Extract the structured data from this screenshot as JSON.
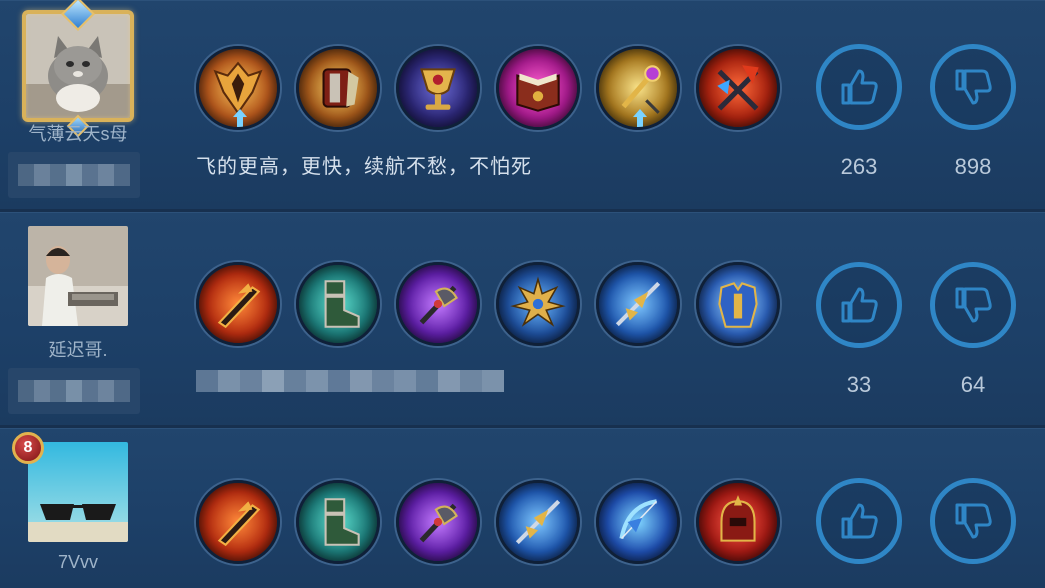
{
  "comments": [
    {
      "username": "气薄云天s母",
      "avatar": "cat-photo",
      "frame": "gold-gem-frame",
      "level_badge": "",
      "comment": "飞的更高，更快，续航不愁，不怕死",
      "likes": "263",
      "dislikes": "898",
      "items": [
        "golden-wing-armor",
        "red-cape-armor",
        "golden-goblet",
        "spell-book",
        "golden-scepter",
        "red-crossed-blades"
      ],
      "upgrade_arrows": [
        0,
        4
      ]
    },
    {
      "username": "延迟哥.",
      "avatar": "man-photo",
      "frame": "",
      "level_badge": "",
      "comment": "",
      "likes": "33",
      "dislikes": "64",
      "items": [
        "flame-sword",
        "green-boots",
        "purple-axe",
        "golden-trident",
        "blue-spear",
        "blue-armor"
      ],
      "upgrade_arrows": []
    },
    {
      "username": "7Vvv",
      "avatar": "sunglasses-photo",
      "frame": "",
      "level_badge": "8",
      "comment": "",
      "likes": "",
      "dislikes": "",
      "items": [
        "flame-sword",
        "green-boots",
        "purple-axe",
        "golden-trident",
        "blue-bow",
        "red-helmet"
      ],
      "upgrade_arrows": []
    }
  ],
  "icons": {
    "like": "thumbs-up-icon",
    "dislike": "thumbs-down-icon"
  },
  "colors": {
    "vote_ring": "#2f86c6",
    "background": "#1c3c62"
  }
}
